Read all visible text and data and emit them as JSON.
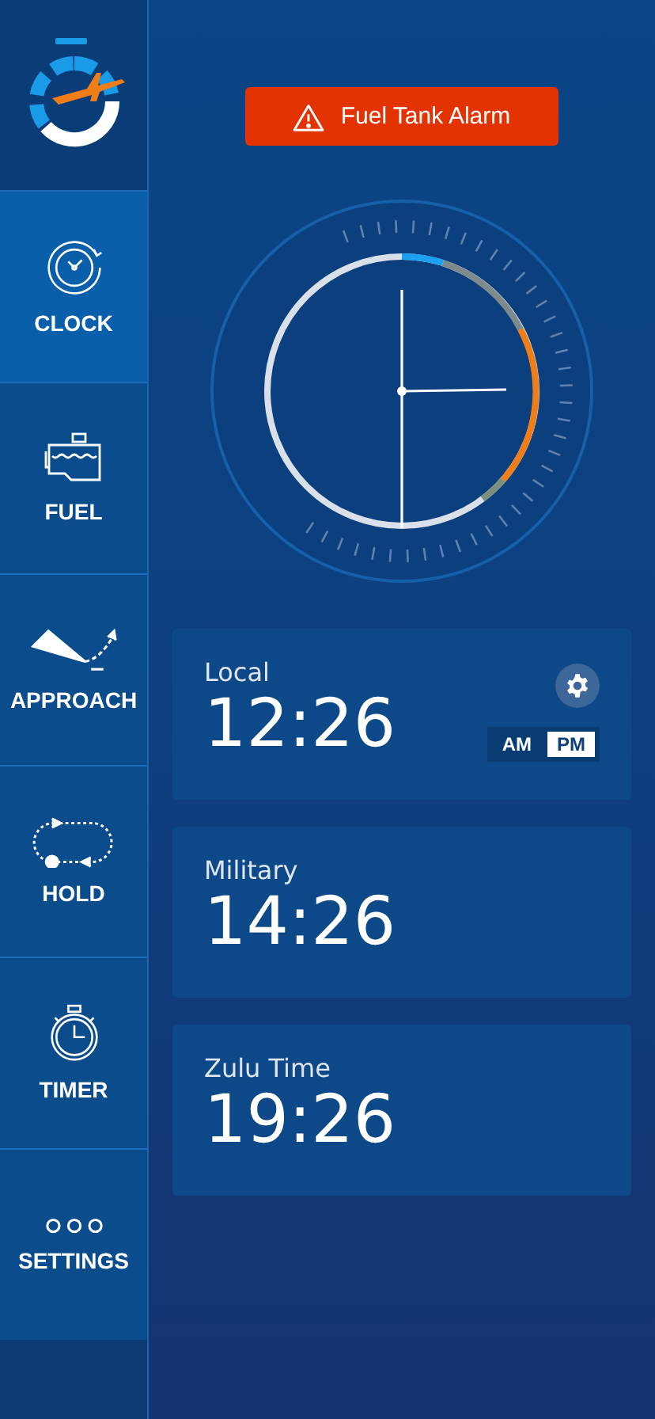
{
  "sidebar": {
    "items": [
      {
        "kind": "clock",
        "label": "CLOCK",
        "selected": true
      },
      {
        "kind": "fuel",
        "label": "FUEL",
        "selected": false
      },
      {
        "kind": "approach",
        "label": "APPROACH",
        "selected": false
      },
      {
        "kind": "hold",
        "label": "HOLD",
        "selected": false
      },
      {
        "kind": "timer",
        "label": "TIMER",
        "selected": false
      },
      {
        "kind": "settings",
        "label": "SETTINGS",
        "selected": false
      }
    ]
  },
  "alarm": {
    "label": "Fuel Tank Alarm"
  },
  "cards": [
    {
      "label": "Local",
      "time": "12:26",
      "settings": true,
      "period": [
        {
          "label": "AM",
          "selected": false
        },
        {
          "label": "PM",
          "selected": true
        }
      ]
    },
    {
      "label": "Military",
      "time": "14:26",
      "settings": false
    },
    {
      "label": "Zulu Time",
      "time": "19:26",
      "settings": false
    }
  ]
}
